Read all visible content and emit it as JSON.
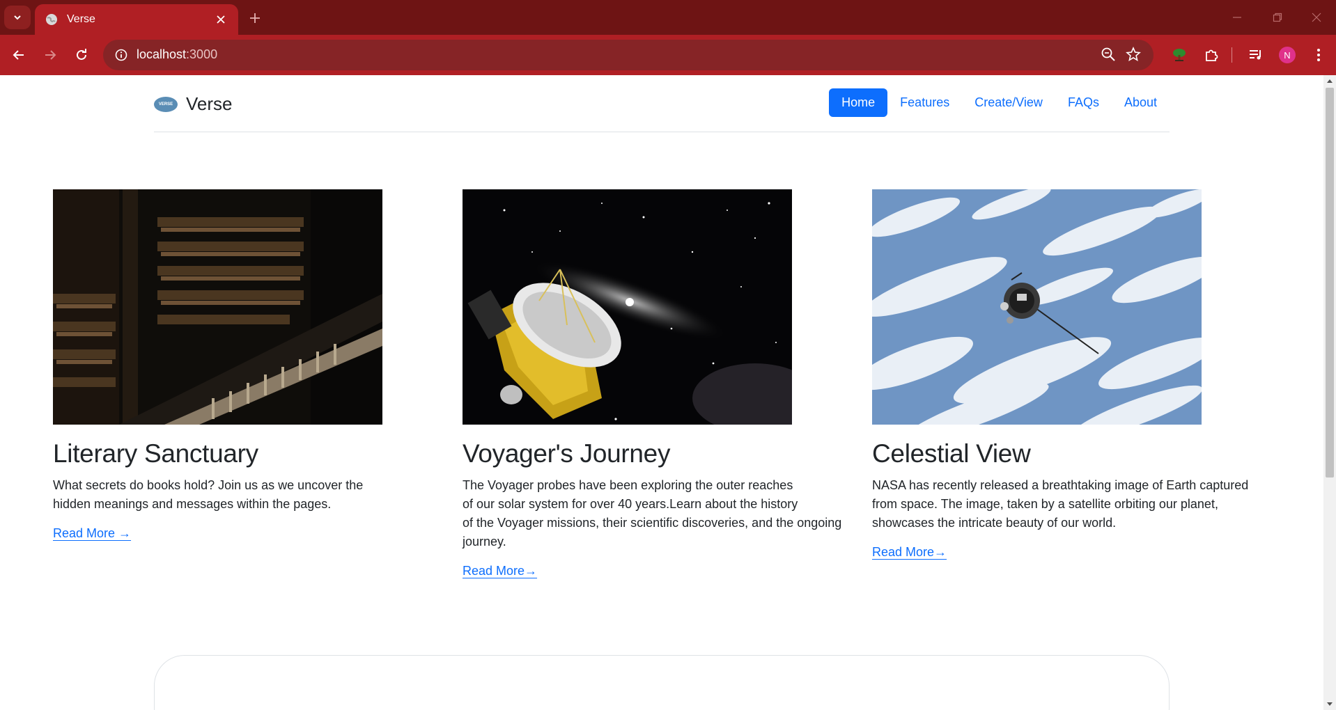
{
  "browser": {
    "tab_title": "Verse",
    "url_host": "localhost",
    "url_port": ":3000",
    "avatar_letter": "N",
    "colors": {
      "tabstrip": "#6e1414",
      "toolbar": "#b01f24",
      "omnibox": "#862426"
    },
    "icons": [
      "tab-search-icon",
      "globe-icon",
      "close-icon",
      "plus-icon",
      "minimize-icon",
      "restore-icon",
      "window-close-icon",
      "back-arrow-icon",
      "forward-arrow-icon",
      "reload-icon",
      "info-icon",
      "zoom-icon",
      "star-icon",
      "tree-extension-icon",
      "puzzle-icon",
      "media-control-icon",
      "kebab-menu-icon"
    ]
  },
  "site": {
    "brand_name": "Verse",
    "logo_text": "VERSE",
    "nav": [
      {
        "label": "Home",
        "active": true
      },
      {
        "label": "Features",
        "active": false
      },
      {
        "label": "Create/View",
        "active": false
      },
      {
        "label": "FAQs",
        "active": false
      },
      {
        "label": "About",
        "active": false
      }
    ],
    "accent_color": "#0d6efd"
  },
  "cards": [
    {
      "title": "Literary Sanctuary",
      "body": "What secrets do books hold? Join us as we uncover the\nhidden meanings and messages within the pages.",
      "link": "Read More →"
    },
    {
      "title": "Voyager's Journey",
      "body": "The Voyager probes have been exploring the outer reaches\nof our solar system for over 40 years.Learn about the history\nof the Voyager missions, their scientific discoveries, and the ongoing\njourney.",
      "link": "Read More→"
    },
    {
      "title": "Celestial View",
      "body": "NASA has recently released a breathtaking image of Earth captured\nfrom space. The image, taken by a satellite orbiting our planet,\nshowcases the intricate beauty of our world.",
      "link": "Read More→"
    }
  ]
}
